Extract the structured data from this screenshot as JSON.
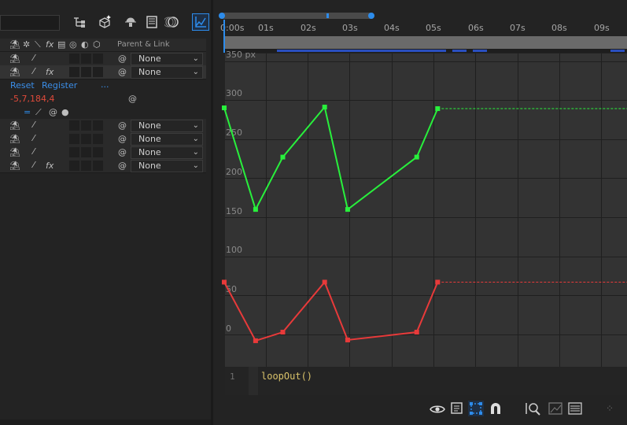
{
  "colors": {
    "accent": "#2d8ceb",
    "green": "#28f03c",
    "red": "#e83a3a",
    "panel": "#232323",
    "graph_bg": "#333333"
  },
  "search": {
    "value": ""
  },
  "header_columns": {
    "parent_link": "Parent & Link"
  },
  "layers": [
    {
      "parent": "None",
      "fx": false
    },
    {
      "parent": "None",
      "fx": true
    },
    {
      "parent": "None",
      "fx": false
    },
    {
      "parent": "None",
      "fx": false
    },
    {
      "parent": "None",
      "fx": false
    },
    {
      "parent": "None",
      "fx": true
    }
  ],
  "effect": {
    "reset": "Reset",
    "register": "Register",
    "ellipsis": "...",
    "value": "-5,7,184,4"
  },
  "ruler": {
    "ticks": [
      "0:00s",
      "01s",
      "02s",
      "03s",
      "04s",
      "05s",
      "06s",
      "07s",
      "08s",
      "09s"
    ]
  },
  "graph": {
    "y_labels": [
      "350 px",
      "300",
      "250",
      "200",
      "150",
      "100",
      "50",
      "0"
    ],
    "green_keys": [
      [
        0,
        290
      ],
      [
        0.75,
        160
      ],
      [
        1.4,
        227
      ],
      [
        2.4,
        291
      ],
      [
        2.95,
        160
      ],
      [
        4.6,
        227
      ],
      [
        5.1,
        289
      ]
    ],
    "red_keys": [
      [
        0,
        67
      ],
      [
        0.75,
        -8
      ],
      [
        1.4,
        3
      ],
      [
        2.4,
        67
      ],
      [
        2.95,
        -7
      ],
      [
        4.6,
        3
      ],
      [
        5.1,
        67
      ]
    ]
  },
  "expression": {
    "line_number": "1",
    "code": "loopOut()"
  },
  "icons": [
    "eye-icon",
    "clipboard-icon",
    "transform-box-icon",
    "snap-magnet-icon",
    "fit-zoom-icon",
    "graph-type-icon",
    "ease-graph-icon"
  ]
}
